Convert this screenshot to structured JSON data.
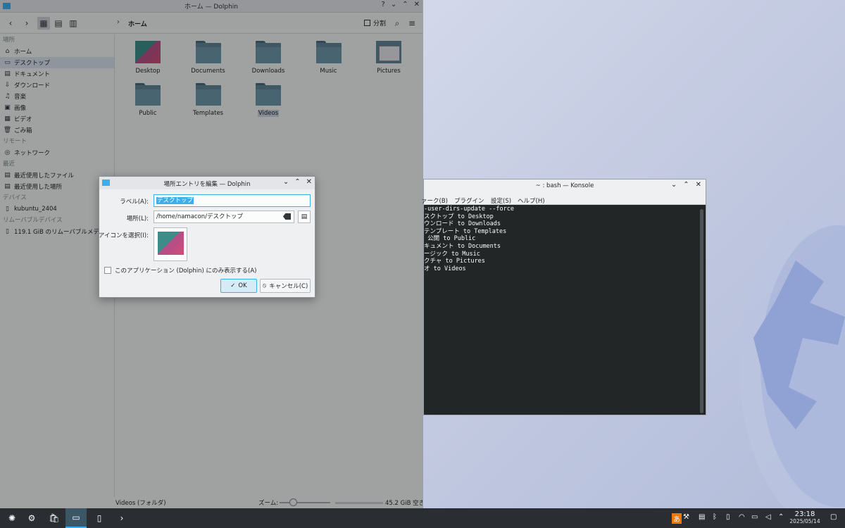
{
  "dolphin": {
    "title": "ホーム — Dolphin",
    "title_buttons": [
      "?",
      "⌄",
      "⌃",
      "✕"
    ],
    "breadcrumb": "ホーム",
    "split_label": "分割",
    "sidebar": {
      "sections": [
        {
          "header": "場所",
          "items": [
            {
              "icon": "home-icon",
              "glyph": "⌂",
              "label": "ホーム"
            },
            {
              "icon": "desktop-icon",
              "glyph": "▭",
              "label": "デスクトップ",
              "selected": true
            },
            {
              "icon": "document-icon",
              "glyph": "▤",
              "label": "ドキュメント"
            },
            {
              "icon": "download-icon",
              "glyph": "⇩",
              "label": "ダウンロード"
            },
            {
              "icon": "music-icon",
              "glyph": "♫",
              "label": "音楽"
            },
            {
              "icon": "image-icon",
              "glyph": "▣",
              "label": "画像"
            },
            {
              "icon": "video-icon",
              "glyph": "▦",
              "label": "ビデオ"
            },
            {
              "icon": "trash-icon",
              "glyph": "🗑",
              "label": "ごみ箱"
            }
          ]
        },
        {
          "header": "リモート",
          "items": [
            {
              "icon": "network-icon",
              "glyph": "◎",
              "label": "ネットワーク"
            }
          ]
        },
        {
          "header": "最近",
          "items": [
            {
              "icon": "recent-files-icon",
              "glyph": "▤",
              "label": "最近使用したファイル"
            },
            {
              "icon": "recent-places-icon",
              "glyph": "▤",
              "label": "最近使用した場所"
            }
          ]
        },
        {
          "header": "デバイス",
          "items": [
            {
              "icon": "drive-icon",
              "glyph": "▯",
              "label": "kubuntu_2404"
            }
          ]
        },
        {
          "header": "リムーバブルデバイス",
          "items": [
            {
              "icon": "usb-drive-icon",
              "glyph": "▯",
              "label": "119.1 GiB のリムーバブルメディ"
            }
          ]
        }
      ]
    },
    "files": [
      {
        "name": "Desktop",
        "kind": "desktop"
      },
      {
        "name": "Documents",
        "kind": "folder"
      },
      {
        "name": "Downloads",
        "kind": "folder"
      },
      {
        "name": "Music",
        "kind": "folder"
      },
      {
        "name": "Pictures",
        "kind": "pictures"
      },
      {
        "name": "Public",
        "kind": "folder"
      },
      {
        "name": "Templates",
        "kind": "folder"
      },
      {
        "name": "Videos",
        "kind": "folder",
        "selected": true
      }
    ],
    "status": {
      "selection": "Videos (フォルダ)",
      "zoom_label": "ズーム:",
      "free_space": "45.2 GiB 空き"
    }
  },
  "konsole": {
    "title": "~ : bash — Konsole",
    "menu": [
      "ァーク(B)",
      "プラグイン",
      "設定(S)",
      "ヘルプ(H)"
    ],
    "lines": [
      "-user-dirs-update --force",
      "スクトップ to Desktop",
      "ウンロード to Downloads",
      "テンプレート to Templates",
      " 公開 to Public",
      "キュメント to Documents",
      "ージック to Music",
      "クチャ to Pictures",
      "オ to Videos"
    ]
  },
  "dialog": {
    "title": "場所エントリを編集 — Dolphin",
    "label_caption": "ラベル(A):",
    "label_value": "デスクトップ",
    "location_caption": "場所(L):",
    "location_value": "/home/namacon/デスクトップ",
    "icon_caption": "アイコンを選択(I):",
    "checkbox_label": "このアプリケーション (Dolphin) にのみ表示する(A)",
    "ok_label": "OK",
    "cancel_label": "キャンセル(C)"
  },
  "taskbar": {
    "apps": [
      {
        "icon": "app-launcher-icon",
        "glyph": "✺"
      },
      {
        "icon": "system-settings-icon",
        "glyph": "⚙"
      },
      {
        "icon": "discover-icon",
        "glyph": "🛍"
      },
      {
        "icon": "dolphin-icon",
        "glyph": "▭",
        "active": true
      },
      {
        "icon": "kate-icon",
        "glyph": "▯"
      },
      {
        "icon": "konsole-icon",
        "glyph": "›"
      }
    ],
    "tray": [
      "input-method-icon",
      "tools-icon",
      "clipboard-icon",
      "bluetooth-icon",
      "usb-icon",
      "wifi-icon",
      "battery-icon",
      "volume-icon",
      "expand-tray-icon",
      "show-desktop-icon"
    ],
    "clock_time": "23:18",
    "clock_date": "2025/05/14"
  },
  "colors": {
    "accent": "#3daee9",
    "taskbar": "#2a2e32",
    "terminal_bg": "#232627"
  }
}
